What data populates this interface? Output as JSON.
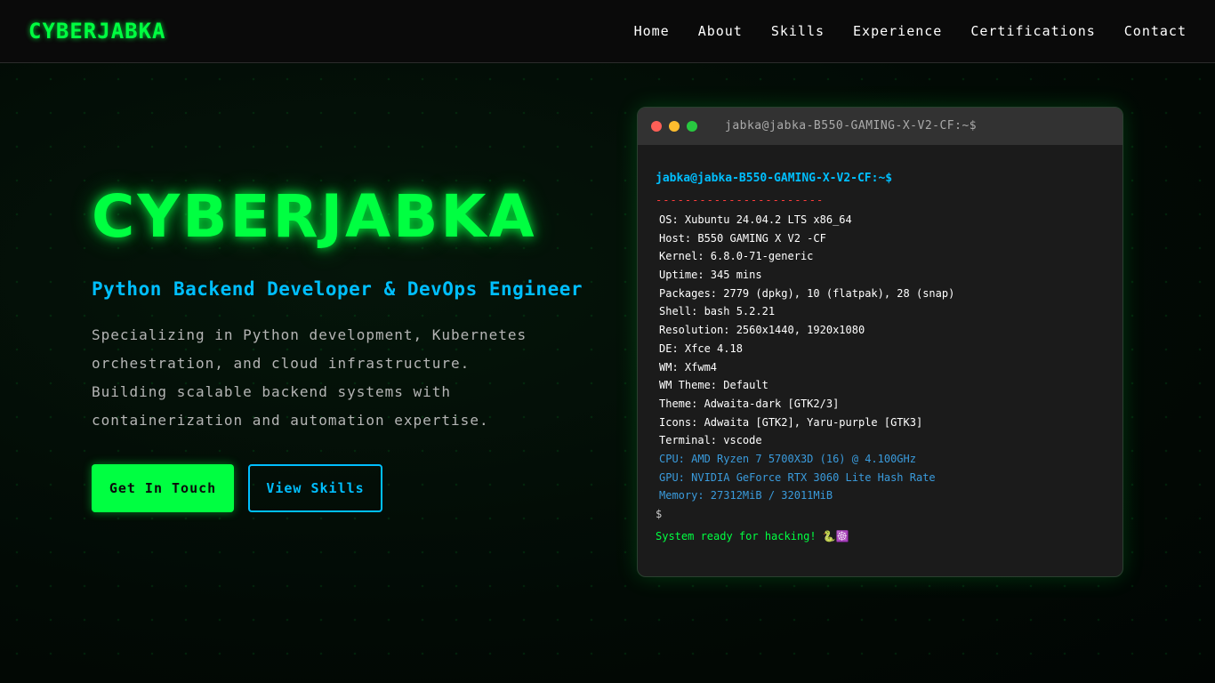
{
  "nav": {
    "brand": "CYBERJABKA",
    "links": [
      "Home",
      "About",
      "Skills",
      "Experience",
      "Certifications",
      "Contact"
    ]
  },
  "hero": {
    "title": "CYBERJABKA",
    "subtitle": "Python Backend Developer & DevOps Engineer",
    "description": "Specializing in Python development, Kubernetes orchestration, and cloud infrastructure. Building scalable backend systems with containerization and automation expertise.",
    "primary_button": "Get In Touch",
    "secondary_button": "View Skills"
  },
  "terminal": {
    "title": "jabka@jabka-B550-GAMING-X-V2-CF:~$",
    "prompt": "jabka@jabka-B550-GAMING-X-V2-CF:~$",
    "separator": "-----------------------",
    "info": [
      "OS: Xubuntu 24.04.2 LTS x86_64",
      "Host: B550 GAMING X V2 -CF",
      "Kernel: 6.8.0-71-generic",
      "Uptime: 345 mins",
      "Packages: 2779 (dpkg), 10 (flatpak), 28 (snap)",
      "Shell: bash 5.2.21",
      "Resolution: 2560x1440, 1920x1080",
      "DE: Xfce 4.18",
      "WM: Xfwm4",
      "WM Theme: Default",
      "Theme: Adwaita-dark [GTK2/3]",
      "Icons: Adwaita [GTK2], Yaru-purple [GTK3]",
      "Terminal: vscode"
    ],
    "hardware": [
      "CPU: AMD Ryzen 7 5700X3D (16) @ 4.100GHz",
      "GPU: NVIDIA GeForce RTX 3060 Lite Hash Rate",
      "Memory: 27312MiB / 32011MiB"
    ],
    "cursor": "$",
    "ready_message": "System ready for hacking! 🐍☸️",
    "window_dots": [
      "#ff5f57",
      "#febc2e",
      "#28c840"
    ]
  },
  "colors": {
    "accent_green": "#00ff41",
    "accent_blue": "#00bfff"
  }
}
